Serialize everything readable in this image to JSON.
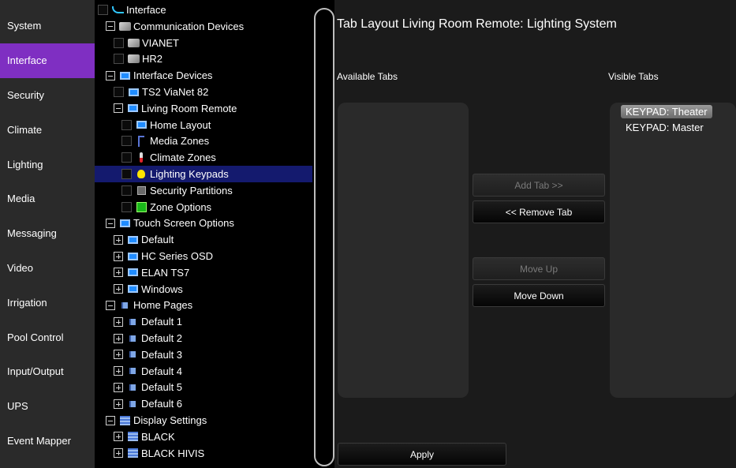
{
  "sidebar": {
    "items": [
      {
        "label": "System"
      },
      {
        "label": "Interface",
        "active": true
      },
      {
        "label": "Security"
      },
      {
        "label": "Climate"
      },
      {
        "label": "Lighting"
      },
      {
        "label": "Media"
      },
      {
        "label": "Messaging"
      },
      {
        "label": "Video"
      },
      {
        "label": "Irrigation"
      },
      {
        "label": "Pool Control"
      },
      {
        "label": "Input/Output"
      },
      {
        "label": "UPS"
      },
      {
        "label": "Event Mapper"
      }
    ]
  },
  "tree": {
    "rows": [
      {
        "label": "Interface",
        "icon": "curve-icon",
        "control": "checkbox"
      },
      {
        "label": "Communication Devices",
        "icon": "device-icon",
        "control": "collapse"
      },
      {
        "label": "VIANET",
        "icon": "device-icon",
        "control": "checkbox"
      },
      {
        "label": "HR2",
        "icon": "device-icon",
        "control": "checkbox"
      },
      {
        "label": "Interface Devices",
        "icon": "screen-icon",
        "control": "collapse"
      },
      {
        "label": "TS2 ViaNet 82",
        "icon": "screen-icon",
        "control": "checkbox"
      },
      {
        "label": "Living Room Remote",
        "icon": "screen-icon",
        "control": "collapse"
      },
      {
        "label": "Home Layout",
        "icon": "screen-icon",
        "control": "checkbox"
      },
      {
        "label": "Media Zones",
        "icon": "music-note-icon",
        "control": "checkbox"
      },
      {
        "label": "Climate Zones",
        "icon": "thermometer-icon",
        "control": "checkbox"
      },
      {
        "label": "Lighting Keypads",
        "icon": "bulb-icon",
        "control": "checkbox",
        "selected": true
      },
      {
        "label": "Security Partitions",
        "icon": "shield-icon",
        "control": "checkbox"
      },
      {
        "label": "Zone Options",
        "icon": "zone-icon",
        "control": "checkbox"
      },
      {
        "label": "Touch Screen Options",
        "icon": "screen-icon",
        "control": "collapse"
      },
      {
        "label": "Default",
        "icon": "screen-icon",
        "control": "expand"
      },
      {
        "label": "HC Series OSD",
        "icon": "screen-icon",
        "control": "expand"
      },
      {
        "label": "ELAN TS7",
        "icon": "screen-icon",
        "control": "expand"
      },
      {
        "label": "Windows",
        "icon": "screen-icon",
        "control": "expand"
      },
      {
        "label": "Home Pages",
        "icon": "page-icon",
        "control": "collapse"
      },
      {
        "label": "Default 1",
        "icon": "page-icon",
        "control": "expand"
      },
      {
        "label": "Default 2",
        "icon": "page-icon",
        "control": "expand"
      },
      {
        "label": "Default 3",
        "icon": "page-icon",
        "control": "expand"
      },
      {
        "label": "Default 4",
        "icon": "page-icon",
        "control": "expand"
      },
      {
        "label": "Default 5",
        "icon": "page-icon",
        "control": "expand"
      },
      {
        "label": "Default 6",
        "icon": "page-icon",
        "control": "expand"
      },
      {
        "label": "Display Settings",
        "icon": "display-icon",
        "control": "collapse"
      },
      {
        "label": "BLACK",
        "icon": "display-icon",
        "control": "expand"
      },
      {
        "label": "BLACK HIVIS",
        "icon": "display-icon",
        "control": "expand"
      }
    ]
  },
  "main": {
    "title": "Tab Layout Living Room Remote: Lighting System",
    "available_label": "Available Tabs",
    "visible_label": "Visible Tabs",
    "visible_tabs": [
      "KEYPAD: Theater",
      "KEYPAD: Master"
    ],
    "buttons": {
      "add": "Add Tab >>",
      "remove": "<< Remove Tab",
      "move_up": "Move Up",
      "move_down": "Move Down",
      "apply": "Apply"
    }
  }
}
